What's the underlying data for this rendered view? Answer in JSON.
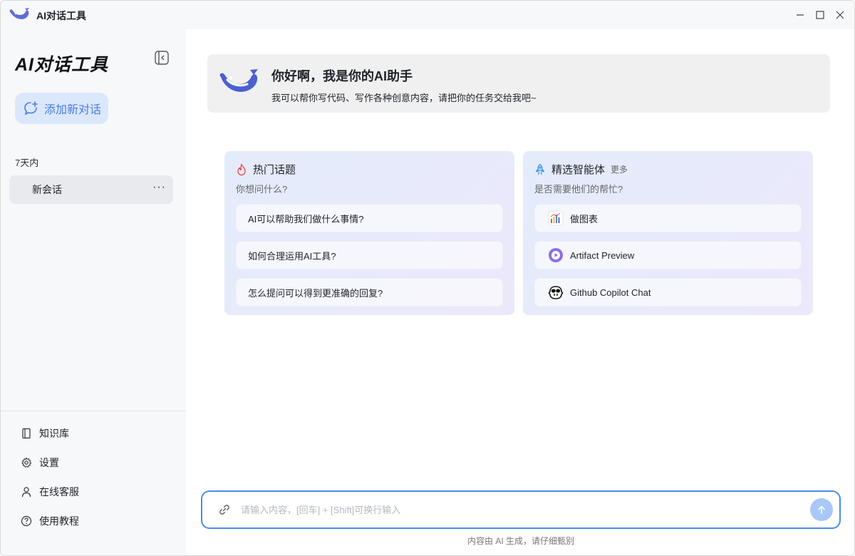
{
  "window": {
    "title": "AI对话工具"
  },
  "sidebar": {
    "brand": "AI对话工具",
    "new_chat_label": "添加新对话",
    "section_label": "7天内",
    "conversations": [
      {
        "label": "新会话",
        "more": "···"
      }
    ],
    "links": [
      {
        "label": "知识库",
        "icon": "book-icon"
      },
      {
        "label": "设置",
        "icon": "gear-icon"
      },
      {
        "label": "在线客服",
        "icon": "user-icon"
      },
      {
        "label": "使用教程",
        "icon": "help-icon"
      }
    ]
  },
  "welcome": {
    "title": "你好啊，我是你的AI助手",
    "subtitle": "我可以帮你写代码、写作各种创意内容，请把你的任务交给我吧~"
  },
  "hot_topics": {
    "title": "热门话题",
    "subtitle": "你想问什么?",
    "items": [
      "AI可以帮助我们做什么事情?",
      "如何合理运用AI工具?",
      "怎么提问可以得到更准确的回复?"
    ]
  },
  "agents": {
    "title": "精选智能体",
    "more": "更多",
    "subtitle": "是否需要他们的帮忙?",
    "items": [
      {
        "label": "做图表",
        "icon": "chart-icon"
      },
      {
        "label": "Artifact Preview",
        "icon": "play-icon"
      },
      {
        "label": "Github Copilot Chat",
        "icon": "copilot-icon"
      }
    ]
  },
  "input": {
    "placeholder": "请输入内容，[回车] + [Shift]可换行输入",
    "value": ""
  },
  "disclaimer": "内容由 AI 生成，请仔细甄别",
  "colors": {
    "accent": "#4a8bf0",
    "brand_blue": "#5b6fd6",
    "sidebar_bg": "#f7f8fa",
    "new_chat_bg": "#dbe7fb"
  }
}
